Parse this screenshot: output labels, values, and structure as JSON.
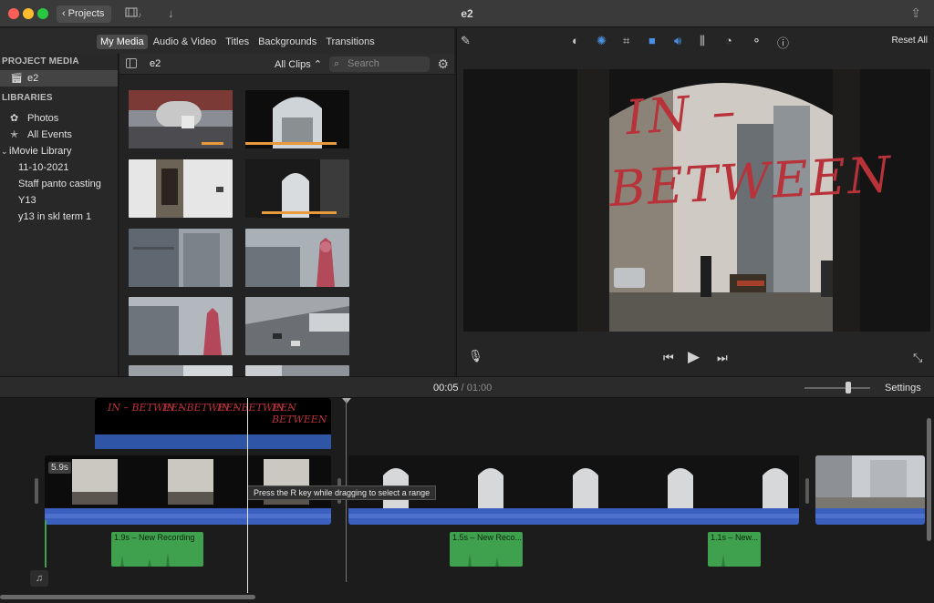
{
  "window": {
    "title": "e2",
    "projects_label": "Projects"
  },
  "browser_tabs": [
    "My Media",
    "Audio & Video",
    "Titles",
    "Backgrounds",
    "Transitions"
  ],
  "sidebar": {
    "project_media_header": "PROJECT MEDIA",
    "project_item": "e2",
    "libraries_header": "LIBRARIES",
    "library_items": [
      {
        "label": "Photos",
        "icon": "flower-icon"
      },
      {
        "label": "All Events",
        "icon": "star-icon"
      }
    ],
    "library_name": "iMovie Library",
    "events": [
      "11-10-2021",
      "Staff panto casting",
      "Y13",
      "y13 in skl term 1"
    ]
  },
  "media_browser": {
    "event_name": "e2",
    "filter": "All Clips",
    "search_placeholder": "Search"
  },
  "viewer": {
    "reset_label": "Reset All",
    "title_overlay_line1": "IN –",
    "title_overlay_line2": "BETWEEN"
  },
  "timeline": {
    "current_time": "00:05",
    "separator": "/",
    "total_time": "01:00",
    "settings_label": "Settings",
    "clip_duration": "5.9s",
    "title_text": "IN – BETWEEN",
    "tooltip": "Press the R key while dragging to select a range",
    "recordings": [
      "1.9s – New Recording",
      "1.5s – New Reco...",
      "1.1s – New..."
    ]
  }
}
